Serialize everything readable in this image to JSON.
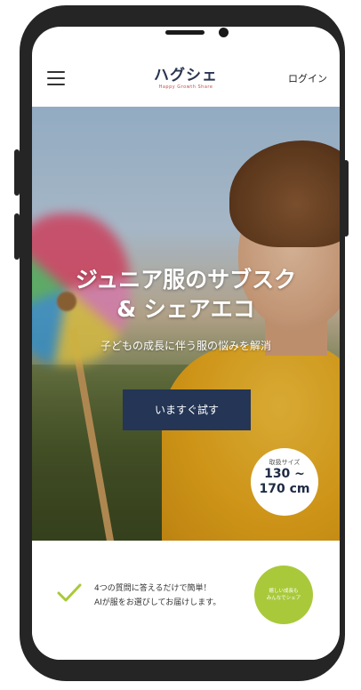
{
  "header": {
    "logo_text": "ハグシェ",
    "logo_tagline": "Happy Growth Share",
    "login_label": "ログイン"
  },
  "hero": {
    "title_line1": "ジュニア服のサブスク",
    "title_line2": "& シェアエコ",
    "subtitle": "子どもの成長に伴う服の悩みを解消",
    "cta_label": "いますぐ試す",
    "size_badge_label": "取扱サイズ",
    "size_badge_from": "130 ~",
    "size_badge_to": "170 cm"
  },
  "bottom": {
    "info_line1": "4つの質問に答えるだけで簡単！",
    "info_line2": "AIが服をお選びしてお届けします。",
    "share_line1": "嬉しい成長も",
    "share_line2": "みんなでシェア"
  },
  "icons": {
    "menu": "hamburger-menu-icon",
    "check": "check-icon"
  },
  "colors": {
    "cta_bg": "#243555",
    "share_badge": "#a9c93a",
    "check": "#a9c93a",
    "phone_frame": "#252525"
  }
}
